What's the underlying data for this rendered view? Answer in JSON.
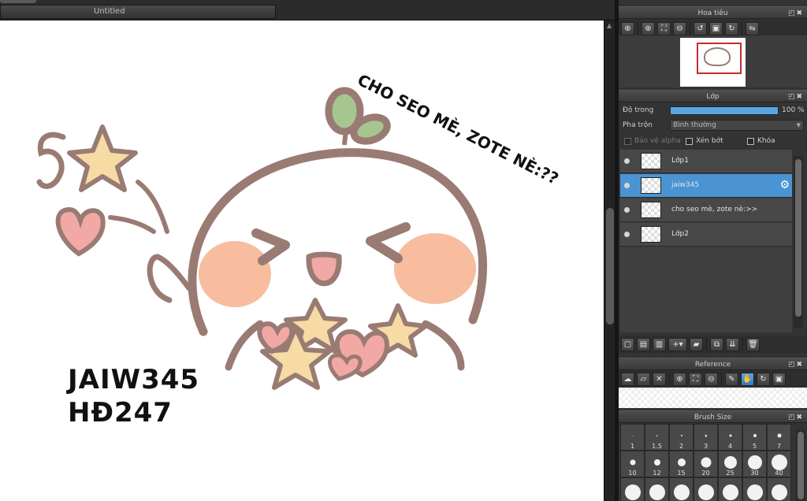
{
  "document": {
    "tab_title": "Untitled"
  },
  "canvas": {
    "speech_text": "CHO SEO MÈ, ZOTE NÈ:??",
    "signature_line1": "JAIW345",
    "signature_line2": "HĐ247"
  },
  "navigator": {
    "title": "Hoa tiêu",
    "tools": [
      "zoom-in-icon",
      "zoom-in-icon",
      "fit-icon",
      "zoom-out-icon",
      "rotate-left-icon",
      "fit-screen-icon",
      "rotate-right-icon",
      "flip-icon"
    ]
  },
  "layers_panel": {
    "title": "Lớp",
    "opacity_label": "Độ trong",
    "opacity_value": "100 %",
    "opacity_fraction": 1.0,
    "blend_label": "Pha trộn",
    "blend_value": "Bình thường",
    "protect_alpha": "Bảo vệ alpha",
    "clipping": "Xén bớt",
    "lock": "Khóa",
    "layers": [
      {
        "name": "Lớp1",
        "selected": false
      },
      {
        "name": "jaiw345",
        "selected": true
      },
      {
        "name": "cho seo mè, zote nè:>>",
        "selected": false
      },
      {
        "name": "Lớp2",
        "selected": false
      }
    ]
  },
  "reference_panel": {
    "title": "Reference"
  },
  "brush_size_panel": {
    "title": "Brush Size",
    "sizes": [
      "1",
      "1.5",
      "2",
      "3",
      "4",
      "5",
      "7",
      "10",
      "12",
      "15",
      "20",
      "25",
      "30",
      "40",
      "",
      "",
      "",
      "",
      "",
      "",
      ""
    ]
  },
  "colors": {
    "accent": "#4a94d4",
    "panel": "#333333",
    "highlight_border": "#c92b2b"
  }
}
